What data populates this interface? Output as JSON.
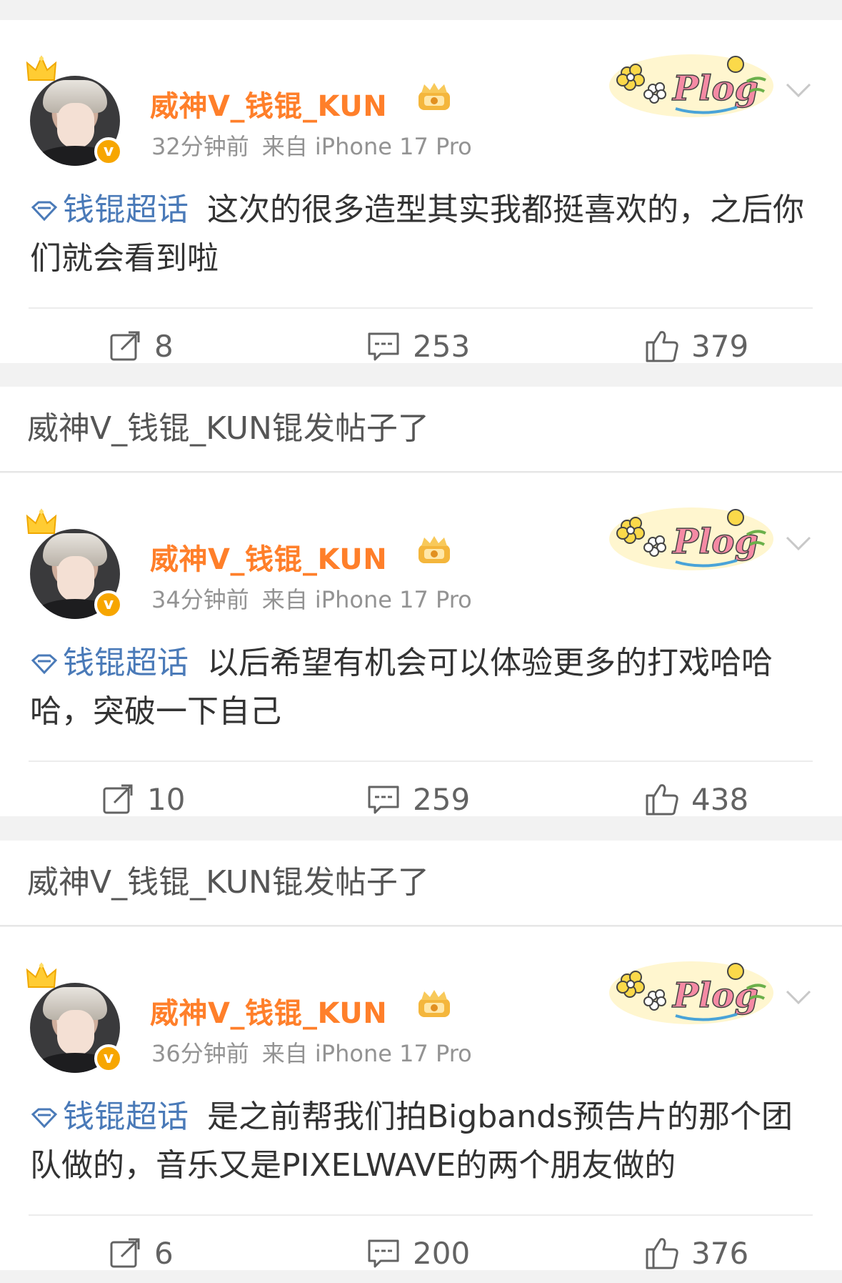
{
  "posts": [
    {
      "username": "威神V_钱锟_KUN",
      "time": "32分钟前",
      "source": "来自 iPhone 17 Pro",
      "badge": "Plog",
      "topic": "钱锟超话",
      "text": "这次的很多造型其实我都挺喜欢的，之后你们就会看到啦",
      "reposts": "8",
      "comments": "253",
      "likes": "379"
    },
    {
      "username": "威神V_钱锟_KUN",
      "time": "34分钟前",
      "source": "来自 iPhone 17 Pro",
      "badge": "Plog",
      "topic": "钱锟超话",
      "text": "以后希望有机会可以体验更多的打戏哈哈哈，突破一下自己",
      "reposts": "10",
      "comments": "259",
      "likes": "438"
    },
    {
      "username": "威神V_钱锟_KUN",
      "time": "36分钟前",
      "source": "来自 iPhone 17 Pro",
      "badge": "Plog",
      "topic": "钱锟超话",
      "text": "是之前帮我们拍Bigbands预告片的那个团队做的，音乐又是PIXELWAVE的两个朋友做的",
      "reposts": "6",
      "comments": "200",
      "likes": "376"
    }
  ],
  "notices": [
    {
      "text": "威神V_钱锟_KUN锟发帖子了"
    },
    {
      "text": "威神V_钱锟_KUN锟发帖子了"
    }
  ],
  "colors": {
    "username": "#ff7f2a",
    "topic": "#4a7ab8",
    "meta": "#939393",
    "verified": "#f7a600"
  },
  "icons": [
    "crown-icon",
    "verified-icon",
    "vip-icon",
    "chevron-down-icon",
    "topic-diamond-icon",
    "repost-icon",
    "comment-icon",
    "like-icon"
  ]
}
